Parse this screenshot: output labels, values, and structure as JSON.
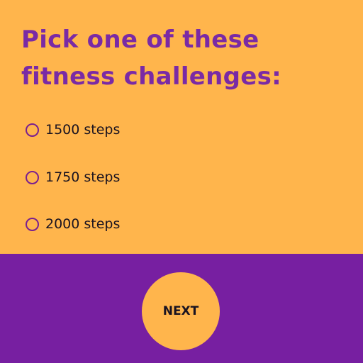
{
  "question": {
    "title": "Pick one of these fitness challenges:"
  },
  "options": [
    {
      "label": "1500 steps",
      "selected": false
    },
    {
      "label": "1750 steps",
      "selected": false
    },
    {
      "label": "2000 steps",
      "selected": false
    }
  ],
  "next_button": {
    "label": "NEXT"
  },
  "colors": {
    "top_background": "#FFB54C",
    "bottom_background": "#771FA1",
    "title_text": "#7A2AA5",
    "radio_border": "#7A1F8F",
    "button_background": "#FFB54C"
  }
}
